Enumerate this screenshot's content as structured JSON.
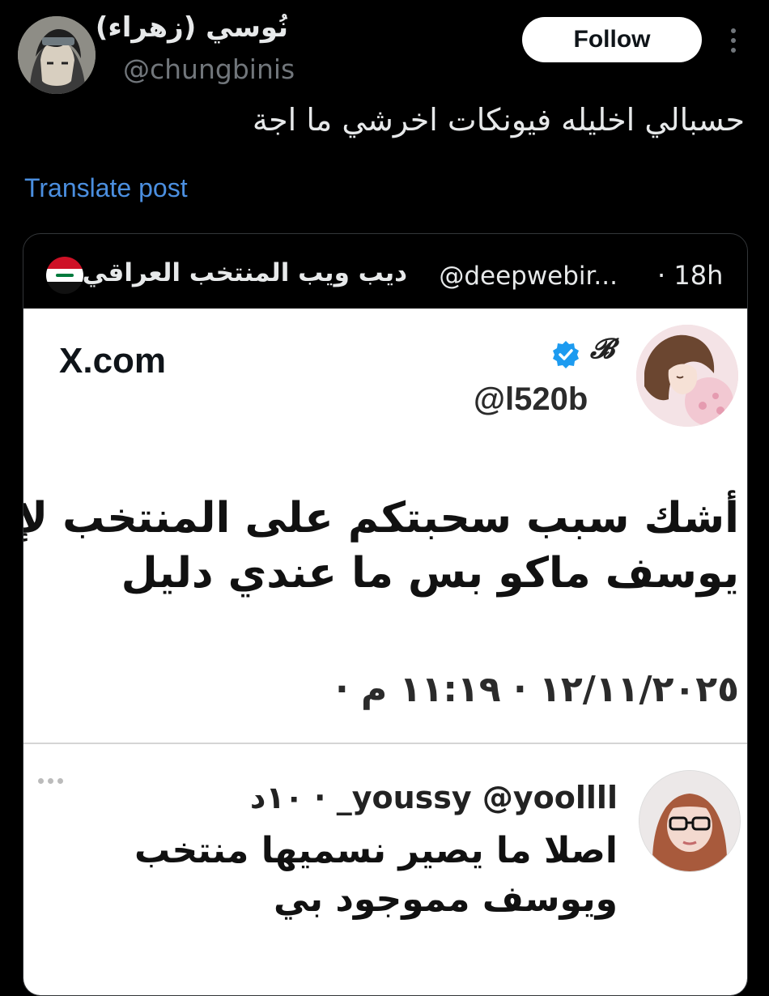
{
  "author": {
    "name": "نُوسي (زهراء)",
    "handle": "@chungbinis",
    "avatar_icon": "anime-avatar"
  },
  "follow_label": "Follow",
  "post_text": "حسبالي اخليله فيونكات اخرشي ما اجة",
  "translate_label": "Translate post",
  "quoted": {
    "name": "ديب ويب المنتخب العراقي",
    "handle": "@deepwebir...",
    "time": "· 18h",
    "flag_icon": "iraq-flag-icon",
    "screenshot": {
      "brand": "X.com",
      "handle": "@l520b",
      "display_initial": "𝓑",
      "text_line1": "أشك سبب سحبتكم على المنتخب لإن",
      "text_line2": "يوسف ماكو بس ما عندي دليل",
      "date": "١٢/١١/٢٠٢٥ · ١١:١٩ م ·",
      "reply": {
        "handle": "youssy @yoollll_ · ١٠د",
        "line1": "اصلا ما يصير نسميها منتخب",
        "line2": "ويوسف مموجود بي"
      }
    }
  },
  "colors": {
    "background": "#000000",
    "primary_text": "#e7e9ea",
    "secondary_text": "#71767b",
    "link": "#4b8fe0",
    "follow_bg": "#ffffff",
    "verified": "#1d9bf0"
  }
}
